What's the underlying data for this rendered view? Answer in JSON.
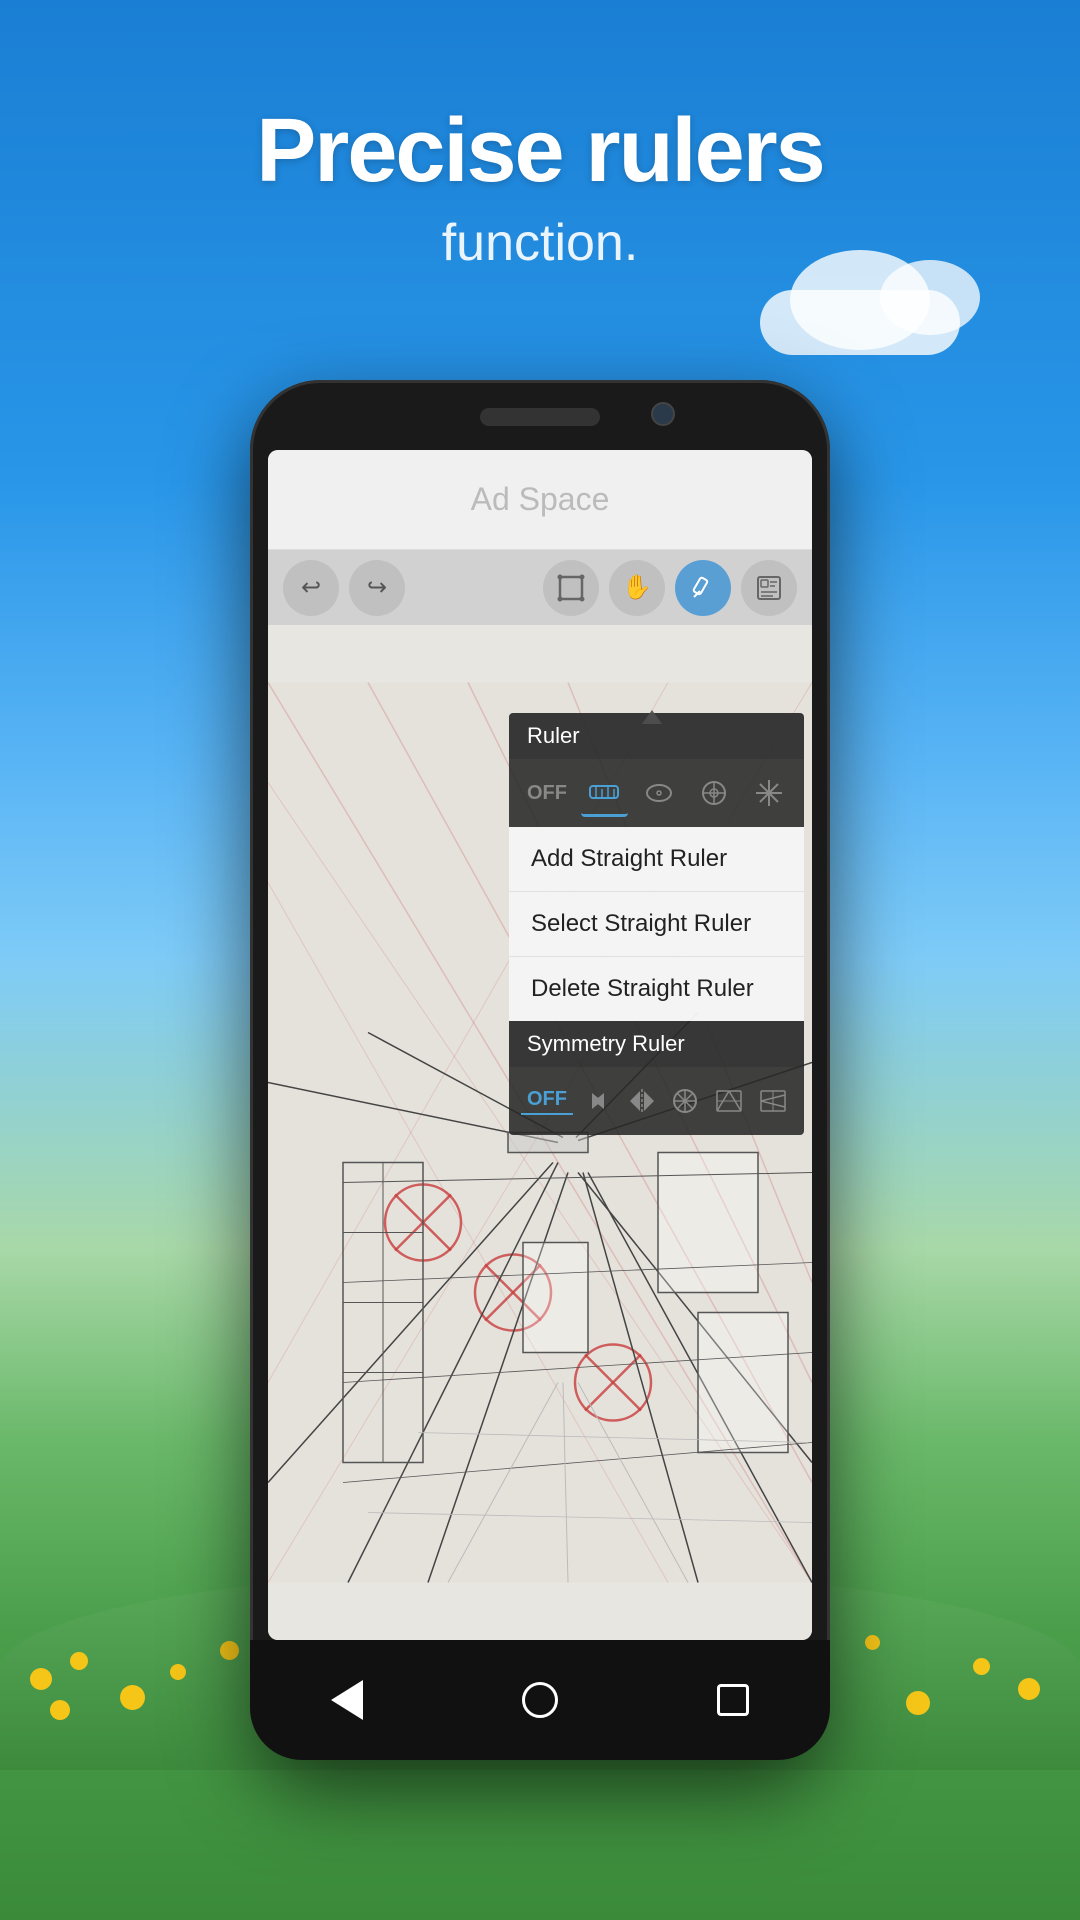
{
  "background": {
    "gradient_desc": "blue sky to green meadow"
  },
  "title": {
    "main": "Precise rulers",
    "sub": "function."
  },
  "ad": {
    "text": "Ad Space"
  },
  "toolbar": {
    "buttons": [
      {
        "icon": "↩",
        "name": "undo"
      },
      {
        "icon": "↪",
        "name": "redo"
      },
      {
        "icon": "⊙",
        "name": "select"
      },
      {
        "icon": "✋",
        "name": "hand"
      },
      {
        "icon": "✏",
        "name": "pen"
      },
      {
        "icon": "🖼",
        "name": "gallery"
      }
    ]
  },
  "ruler_menu": {
    "section_title": "Ruler",
    "off_label": "OFF",
    "ruler_icons": [
      {
        "icon": "📏",
        "name": "straight-ruler",
        "active": true
      },
      {
        "icon": "◎",
        "name": "ellipse-ruler",
        "active": false
      },
      {
        "icon": "⊕",
        "name": "circle-ruler",
        "active": false
      },
      {
        "icon": "✳",
        "name": "radial-ruler",
        "active": false
      }
    ],
    "items": [
      {
        "label": "Add Straight Ruler",
        "name": "add-straight-ruler"
      },
      {
        "label": "Select Straight Ruler",
        "name": "select-straight-ruler"
      },
      {
        "label": "Delete Straight Ruler",
        "name": "delete-straight-ruler"
      }
    ],
    "symmetry_title": "Symmetry Ruler",
    "symmetry_off": "OFF",
    "symmetry_icons": [
      {
        "icon": "▶◀",
        "name": "left-right"
      },
      {
        "icon": "◁▷",
        "name": "flip-h"
      },
      {
        "icon": "⊞",
        "name": "radial-sym"
      },
      {
        "icon": "🔷",
        "name": "perspective-1"
      },
      {
        "icon": "🔶",
        "name": "perspective-2"
      }
    ]
  },
  "nav": {
    "back": "◁",
    "home": "○",
    "recent": "□"
  }
}
